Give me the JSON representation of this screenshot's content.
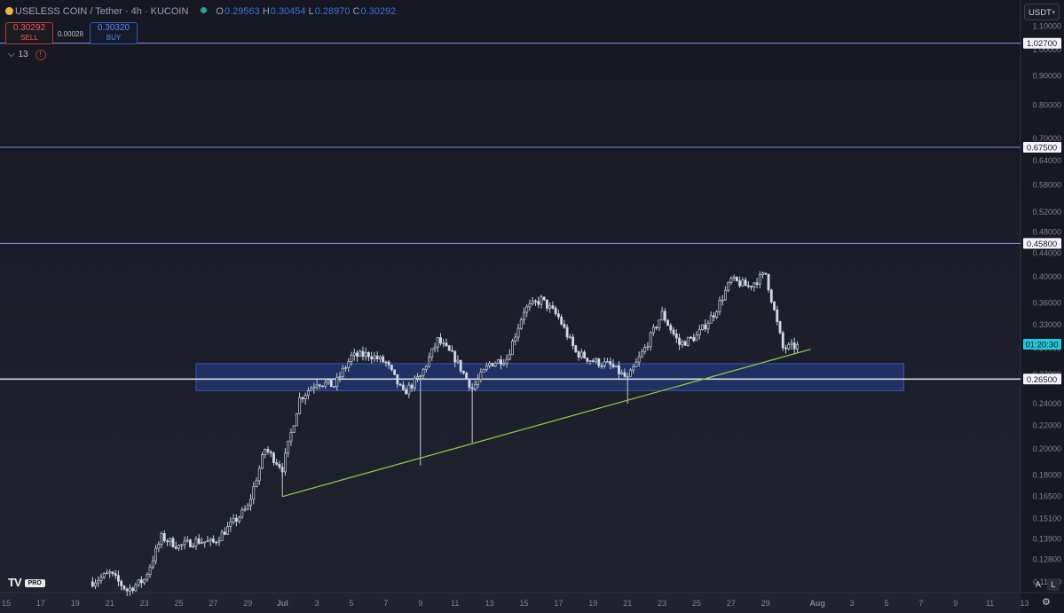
{
  "header": {
    "symbol": "USELESS COIN / Tether · 4h · KUCOIN",
    "ohlc": {
      "o": "0.29563",
      "h": "0.30454",
      "l": "0.28970",
      "c": "0.30292"
    }
  },
  "trade": {
    "sell_price": "0.30292",
    "sell_label": "SELL",
    "spread": "0.00028",
    "buy_price": "0.30320",
    "buy_label": "BUY"
  },
  "indicator_count": "13",
  "indicator_warning": "!",
  "currency": "USDT",
  "branding": {
    "tv": "TV",
    "pro": "PRO"
  },
  "buttons": {
    "auto": "A",
    "log": "L"
  },
  "colors": {
    "bg": "#1c1e2b",
    "candle": "#c4ccdd",
    "trendline": "#8bc34a",
    "zone": "#2a47a0",
    "level": "#7f8bd6",
    "price_tag": "#26c6da"
  },
  "chart_data": {
    "type": "candlestick",
    "scale": "log",
    "y_range": [
      0.112,
      1.13
    ],
    "y_ticks": [
      "1.10000",
      "1.00000",
      "0.90000",
      "0.80000",
      "0.70000",
      "0.64000",
      "0.58000",
      "0.52000",
      "0.48000",
      "0.44000",
      "0.40000",
      "0.36000",
      "0.33000",
      "0.30000",
      "0.27000",
      "0.24000",
      "0.22000",
      "0.20000",
      "0.18000",
      "0.16500",
      "0.15100",
      "0.13900",
      "0.12800",
      "0.11700"
    ],
    "x_ticks": [
      "15",
      "17",
      "19",
      "21",
      "23",
      "25",
      "27",
      "29",
      "Jul",
      "3",
      "5",
      "7",
      "9",
      "11",
      "13",
      "15",
      "17",
      "19",
      "21",
      "23",
      "25",
      "27",
      "29",
      "Aug",
      "3",
      "5",
      "7",
      "9",
      "11",
      "13"
    ],
    "levels": [
      {
        "value": 1.027,
        "label": "1.02700",
        "color": "#7f8bd6"
      },
      {
        "value": 0.675,
        "label": "0.67500",
        "color": "#7f8bd6"
      },
      {
        "value": 0.458,
        "label": "0.45800",
        "color": "#7f8bd6"
      },
      {
        "value": 0.265,
        "label": "0.26500",
        "color": "#d7d9e0"
      }
    ],
    "support_zone": {
      "top": 0.282,
      "bottom": 0.253,
      "from": "Jun 26",
      "to": "Aug 6"
    },
    "trendline": {
      "from": {
        "date": "Jul 1",
        "value": 0.165
      },
      "to": {
        "date": "Jul 31",
        "value": 0.299
      }
    },
    "current_price_label": {
      "value": 0.305,
      "label": "01:20:30"
    },
    "close_path": [
      [
        "Jun 20",
        0.117
      ],
      [
        "Jun 21",
        0.121
      ],
      [
        "Jun 22",
        0.113
      ],
      [
        "Jun 23",
        0.118
      ],
      [
        "Jun 24",
        0.14
      ],
      [
        "Jun 25",
        0.135
      ],
      [
        "Jun 26",
        0.138
      ],
      [
        "Jun 27",
        0.137
      ],
      [
        "Jun 28",
        0.147
      ],
      [
        "Jun 29",
        0.158
      ],
      [
        "Jun 30",
        0.2
      ],
      [
        "Jul 1",
        0.185
      ],
      [
        "Jul 2",
        0.245
      ],
      [
        "Jul 3",
        0.262
      ],
      [
        "Jul 4",
        0.258
      ],
      [
        "Jul 5",
        0.29
      ],
      [
        "Jul 6",
        0.293
      ],
      [
        "Jul 7",
        0.283
      ],
      [
        "Jul 8",
        0.25
      ],
      [
        "Jul 9",
        0.268
      ],
      [
        "Jul 10",
        0.31
      ],
      [
        "Jul 11",
        0.288
      ],
      [
        "Jul 12",
        0.255
      ],
      [
        "Jul 13",
        0.282
      ],
      [
        "Jul 14",
        0.288
      ],
      [
        "Jul 15",
        0.35
      ],
      [
        "Jul 16",
        0.365
      ],
      [
        "Jul 17",
        0.34
      ],
      [
        "Jul 18",
        0.295
      ],
      [
        "Jul 19",
        0.285
      ],
      [
        "Jul 20",
        0.28
      ],
      [
        "Jul 21",
        0.265
      ],
      [
        "Jul 22",
        0.3
      ],
      [
        "Jul 23",
        0.345
      ],
      [
        "Jul 24",
        0.305
      ],
      [
        "Jul 25",
        0.315
      ],
      [
        "Jul 26",
        0.345
      ],
      [
        "Jul 27",
        0.395
      ],
      [
        "Jul 28",
        0.385
      ],
      [
        "Jul 29",
        0.405
      ],
      [
        "Jul 30",
        0.3
      ],
      [
        "Jul 31",
        0.303
      ]
    ]
  }
}
